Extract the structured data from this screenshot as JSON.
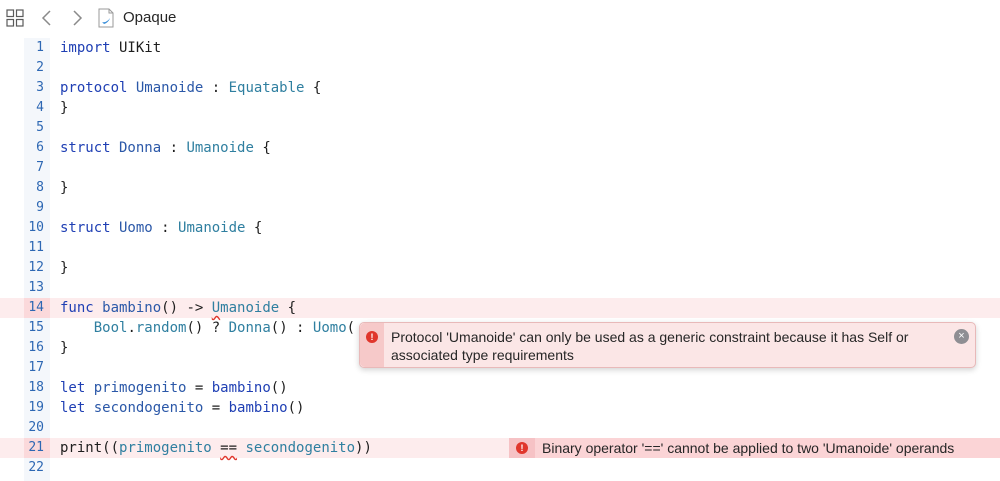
{
  "toolbar": {
    "grid_icon": "grid-icon",
    "back_icon": "chevron-left-icon",
    "forward_icon": "chevron-right-icon",
    "file_icon": "swift-file-icon",
    "file_name": "Opaque"
  },
  "editor": {
    "lines": [
      {
        "n": "1"
      },
      {
        "n": "2"
      },
      {
        "n": "3"
      },
      {
        "n": "4"
      },
      {
        "n": "5"
      },
      {
        "n": "6"
      },
      {
        "n": "7"
      },
      {
        "n": "8"
      },
      {
        "n": "9"
      },
      {
        "n": "10"
      },
      {
        "n": "11"
      },
      {
        "n": "12"
      },
      {
        "n": "13"
      },
      {
        "n": "14"
      },
      {
        "n": "15"
      },
      {
        "n": "16"
      },
      {
        "n": "17"
      },
      {
        "n": "18"
      },
      {
        "n": "19"
      },
      {
        "n": "20"
      },
      {
        "n": "21"
      },
      {
        "n": "22"
      }
    ],
    "code": {
      "l1_kw": "import",
      "l1_rest": " UIKit",
      "l3_kw": "protocol",
      "l3_name": " Umanoide",
      "l3_sep": " : ",
      "l3_type": "Equatable",
      "l3_end": " {",
      "l4": "}",
      "l6_kw": "struct",
      "l6_name": " Donna",
      "l6_sep": " : ",
      "l6_type": "Umanoide",
      "l6_end": " {",
      "l8": "}",
      "l10_kw": "struct",
      "l10_name": " Uomo",
      "l10_sep": " : ",
      "l10_type": "Umanoide",
      "l10_end": " {",
      "l12": "}",
      "l14_kw": "func",
      "l14_name": " bambino",
      "l14_mid": "() -> ",
      "l14_type_first": "U",
      "l14_type_rest": "manoide",
      "l14_end": " {",
      "l15_indent": "    ",
      "l15_bool": "Bool",
      "l15_dot": ".",
      "l15_random": "random",
      "l15_mid": "() ? ",
      "l15_donna": "Donna",
      "l15_mid2": "() : ",
      "l15_uomo": "Uomo",
      "l15_end": "(",
      "l16": "}",
      "l18_kw": "let",
      "l18_name": " primogenito",
      "l18_eq": " = ",
      "l18_call": "bambino",
      "l18_end": "()",
      "l19_kw": "let",
      "l19_name": " secondogenito",
      "l19_eq": " = ",
      "l19_call": "bambino",
      "l19_end": "()",
      "l21_fn": "print",
      "l21_open": "((",
      "l21_a": "primogenito",
      "l21_sp1": " ",
      "l21_op": "==",
      "l21_sp2": " ",
      "l21_b": "secondogenito",
      "l21_close": "))"
    }
  },
  "errors": {
    "popover_message": "Protocol 'Umanoide' can only be used as a generic constraint because it has Self or associated type requirements",
    "inline_message": "Binary operator '==' cannot be applied to two 'Umanoide' operands",
    "icon_glyph": "!",
    "close_glyph": "×"
  },
  "colors": {
    "keyword": "#1f3fb4",
    "type": "#2f7fa0",
    "error_red": "#e0362c",
    "error_line_bg": "#fdeced"
  }
}
